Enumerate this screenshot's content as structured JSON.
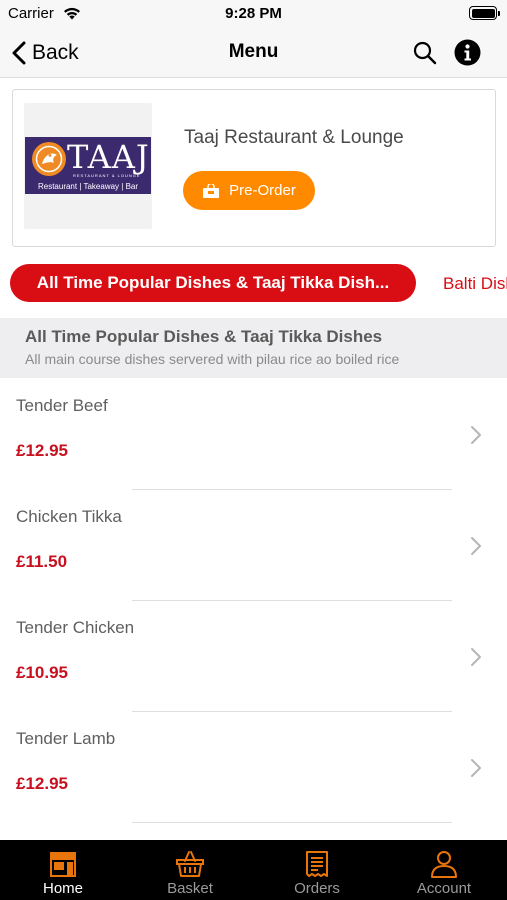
{
  "status_bar": {
    "carrier": "Carrier",
    "time": "9:28 PM"
  },
  "nav": {
    "back_label": "Back",
    "title": "Menu",
    "icons": [
      "search-icon",
      "info-icon"
    ]
  },
  "restaurant": {
    "name": "Taaj Restaurant & Lounge",
    "logo_text": "TAAJ",
    "logo_subtext": "RESTAURANT & LOUNGE",
    "logo_strap": "Restaurant | Takeaway | Bar",
    "preorder_label": "Pre-Order"
  },
  "categories": [
    {
      "label": "All Time Popular Dishes & Taaj Tikka Dish...",
      "active": true
    },
    {
      "label": "Balti Dishes",
      "active": false
    }
  ],
  "section": {
    "title": "All Time Popular Dishes & Taaj Tikka Dishes",
    "subtitle": "All main course dishes servered with pilau rice ao boiled rice"
  },
  "items": [
    {
      "name": "Tender Beef",
      "price": "£12.95"
    },
    {
      "name": "Chicken Tikka",
      "price": "£11.50"
    },
    {
      "name": "Tender Chicken",
      "price": "£10.95"
    },
    {
      "name": "Tender Lamb",
      "price": "£12.95"
    }
  ],
  "tabs": [
    {
      "label": "Home",
      "icon": "shop-icon",
      "active": true
    },
    {
      "label": "Basket",
      "icon": "basket-icon",
      "active": false
    },
    {
      "label": "Orders",
      "icon": "receipt-icon",
      "active": false
    },
    {
      "label": "Account",
      "icon": "user-icon",
      "active": false
    }
  ],
  "colors": {
    "accent_red": "#d90d14",
    "price_red": "#c8101e",
    "preorder_orange": "#ff8a00",
    "tab_icon_orange": "#e8740c",
    "logo_purple": "#3c2a6e"
  }
}
